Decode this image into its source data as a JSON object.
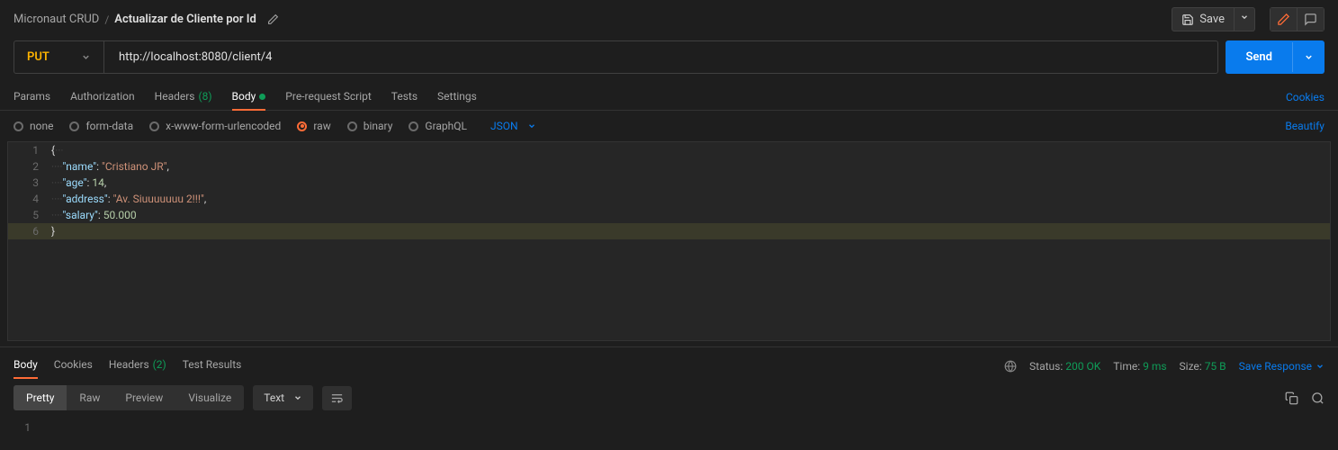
{
  "breadcrumb": {
    "collection": "Micronaut CRUD",
    "separator": "/",
    "request_name": "Actualizar de Cliente por Id"
  },
  "toolbar": {
    "save_label": "Save"
  },
  "request": {
    "method": "PUT",
    "url": "http://localhost:8080/client/4",
    "send_label": "Send"
  },
  "tabs": {
    "params": "Params",
    "authorization": "Authorization",
    "headers": "Headers",
    "headers_count": "(8)",
    "body": "Body",
    "prerequest": "Pre-request Script",
    "tests": "Tests",
    "settings": "Settings",
    "cookies_link": "Cookies"
  },
  "body_types": {
    "none": "none",
    "form_data": "form-data",
    "urlencoded": "x-www-form-urlencoded",
    "raw": "raw",
    "binary": "binary",
    "graphql": "GraphQL",
    "format": "JSON",
    "beautify": "Beautify"
  },
  "body_json": {
    "name": "Cristiano JR",
    "age": 14,
    "address": "Av. Siuuuuuuu 2!!!",
    "salary": 50.0
  },
  "editor_lines": [
    "1",
    "2",
    "3",
    "4",
    "5",
    "6"
  ],
  "response_tabs": {
    "body": "Body",
    "cookies": "Cookies",
    "headers": "Headers",
    "headers_count": "(2)",
    "test_results": "Test Results"
  },
  "response_meta": {
    "status_label": "Status:",
    "status_value": "200 OK",
    "time_label": "Time:",
    "time_value": "9 ms",
    "size_label": "Size:",
    "size_value": "75 B",
    "save_response": "Save Response"
  },
  "view_modes": {
    "pretty": "Pretty",
    "raw": "Raw",
    "preview": "Preview",
    "visualize": "Visualize",
    "format": "Text"
  },
  "response_lines": [
    "1"
  ]
}
